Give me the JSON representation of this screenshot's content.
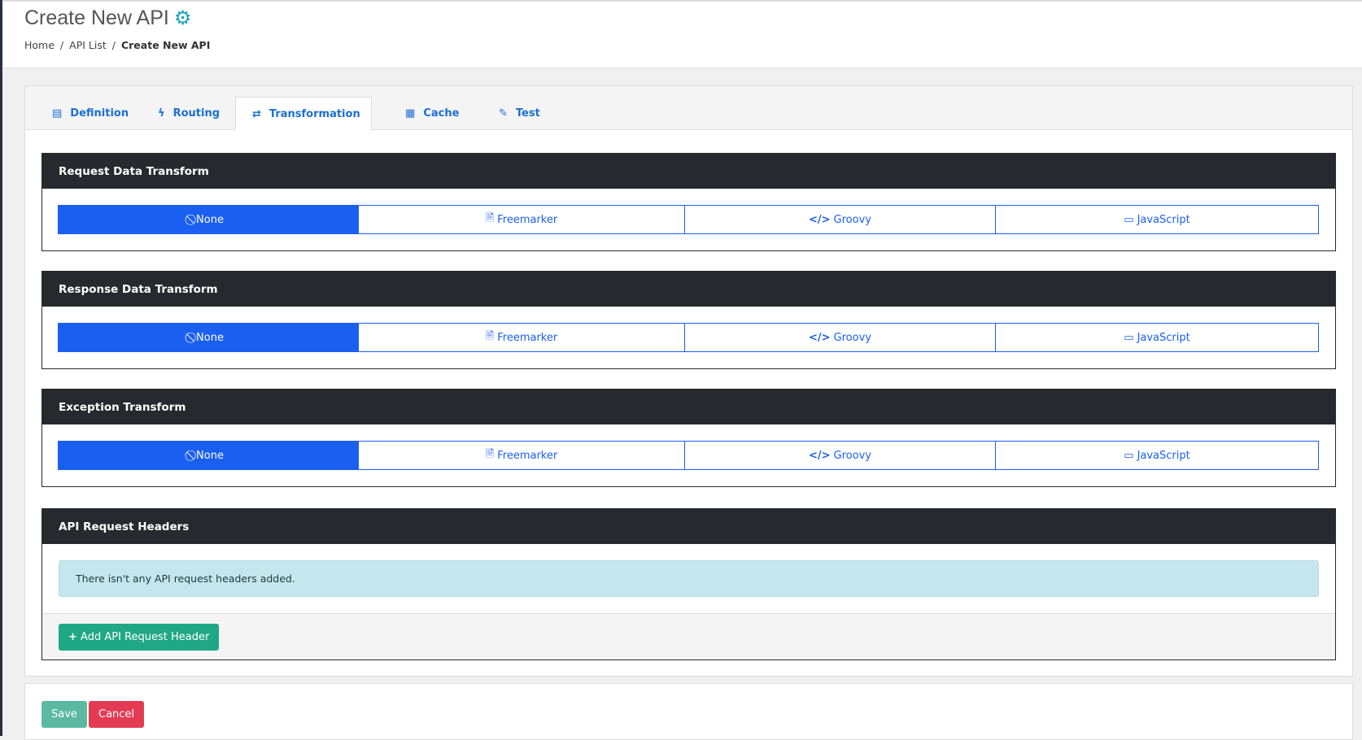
{
  "header": {
    "title": "Create New API",
    "icon": "cogs-icon",
    "breadcrumb": [
      "Home",
      "API List",
      "Create New API"
    ]
  },
  "tabs": [
    {
      "label": "Definition",
      "icon": "id-card-icon"
    },
    {
      "label": "Routing",
      "icon": "bolt-icon"
    },
    {
      "label": "Transformation",
      "icon": "exchange-icon",
      "active": true
    },
    {
      "label": "Cache",
      "icon": "memory-icon"
    },
    {
      "label": "Test",
      "icon": "pen-icon"
    }
  ],
  "panels": [
    {
      "title": "Request Data Transform",
      "selected": "None"
    },
    {
      "title": "Response Data Transform",
      "selected": "None"
    },
    {
      "title": "Exception Transform",
      "selected": "None"
    }
  ],
  "options": [
    "None",
    "Freemarker",
    "Groovy",
    "JavaScript"
  ],
  "headers_panel": {
    "title": "API Request Headers",
    "empty_message": "There isn't any API request headers added.",
    "add_button": "Add API Request Header"
  },
  "actions": {
    "save": "Save",
    "cancel": "Cancel"
  },
  "colors": {
    "primary": "#1a5ff0",
    "dark": "#262a2f",
    "success": "#20a884",
    "danger": "#e43b54",
    "info_bg": "#c5e6ec"
  }
}
